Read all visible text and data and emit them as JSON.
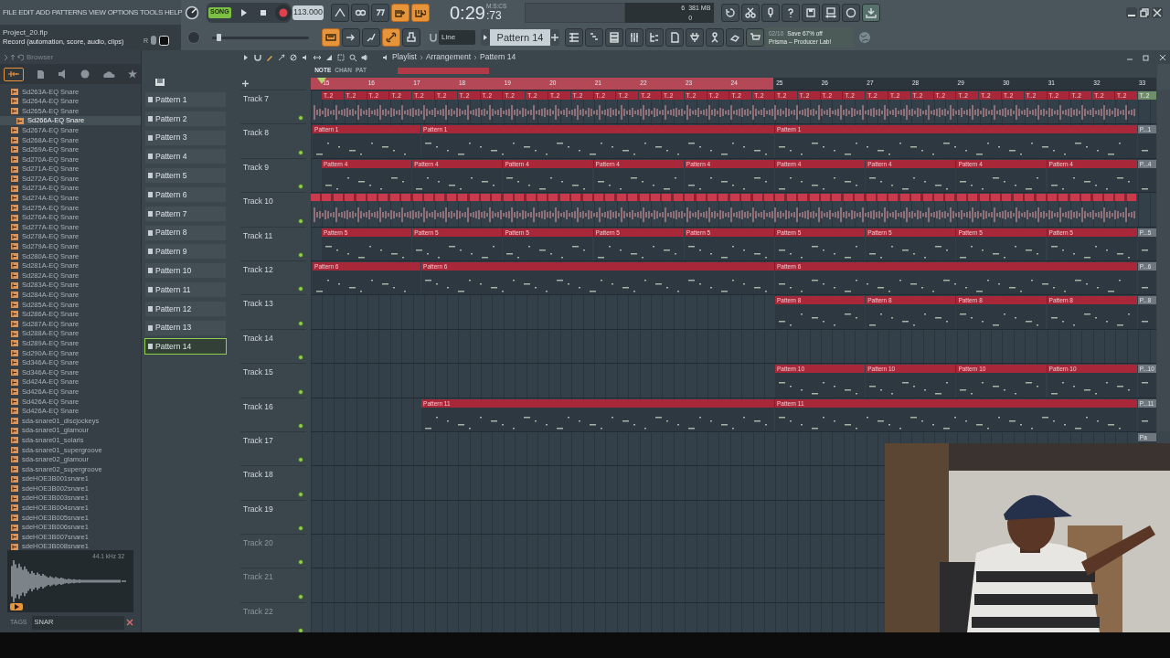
{
  "menu": [
    "FILE",
    "EDIT",
    "ADD",
    "PATTERNS",
    "VIEW",
    "OPTIONS",
    "TOOLS",
    "HELP"
  ],
  "transport": {
    "mode_label": "SONG",
    "song_mode": true,
    "tempo": "113.000"
  },
  "time": {
    "value": "0:29",
    "centis": ":73",
    "unit": "M:S:CS"
  },
  "master_pitch": {
    "level": 0.05
  },
  "monitor": {
    "cpu": "6",
    "ram": "381 MB",
    "voices": "0"
  },
  "hint": {
    "project": "Project_20.flp",
    "text": "Record  (automation, score, audio, clips)",
    "key": "R"
  },
  "snap": "Line",
  "pattern_selector": "Pattern 14",
  "news": {
    "count": "02/10",
    "headline": "Save 67% off",
    "subtitle": "Prisma – Producer Lab!"
  },
  "browser": {
    "title": "Browser",
    "items": [
      {
        "label": "Sd263A-EQ Snare",
        "selected": false
      },
      {
        "label": "Sd264A-EQ Snare",
        "selected": false
      },
      {
        "label": "Sd265A-EQ Snare",
        "selected": false
      },
      {
        "label": "Sd266A-EQ Snare",
        "selected": true
      },
      {
        "label": "Sd267A-EQ Snare",
        "selected": false
      },
      {
        "label": "Sd268A-EQ Snare",
        "selected": false
      },
      {
        "label": "Sd269A-EQ Snare",
        "selected": false
      },
      {
        "label": "Sd270A-EQ Snare",
        "selected": false
      },
      {
        "label": "Sd271A-EQ Snare",
        "selected": false
      },
      {
        "label": "Sd272A-EQ Snare",
        "selected": false
      },
      {
        "label": "Sd273A-EQ Snare",
        "selected": false
      },
      {
        "label": "Sd274A-EQ Snare",
        "selected": false
      },
      {
        "label": "Sd275A-EQ Snare",
        "selected": false
      },
      {
        "label": "Sd276A-EQ Snare",
        "selected": false
      },
      {
        "label": "Sd277A-EQ Snare",
        "selected": false
      },
      {
        "label": "Sd278A-EQ Snare",
        "selected": false
      },
      {
        "label": "Sd279A-EQ Snare",
        "selected": false
      },
      {
        "label": "Sd280A-EQ Snare",
        "selected": false
      },
      {
        "label": "Sd281A-EQ Snare",
        "selected": false
      },
      {
        "label": "Sd282A-EQ Snare",
        "selected": false
      },
      {
        "label": "Sd283A-EQ Snare",
        "selected": false
      },
      {
        "label": "Sd284A-EQ Snare",
        "selected": false
      },
      {
        "label": "Sd285A-EQ Snare",
        "selected": false
      },
      {
        "label": "Sd286A-EQ Snare",
        "selected": false
      },
      {
        "label": "Sd287A-EQ Snare",
        "selected": false
      },
      {
        "label": "Sd288A-EQ Snare",
        "selected": false
      },
      {
        "label": "Sd289A-EQ Snare",
        "selected": false
      },
      {
        "label": "Sd290A-EQ Snare",
        "selected": false
      },
      {
        "label": "Sd346A-EQ Snare",
        "selected": false
      },
      {
        "label": "Sd346A-EQ Snare",
        "selected": false
      },
      {
        "label": "Sd424A-EQ Snare",
        "selected": false
      },
      {
        "label": "Sd426A-EQ Snare",
        "selected": false
      },
      {
        "label": "Sd426A-EQ Snare",
        "selected": false
      },
      {
        "label": "Sd426A-EQ Snare",
        "selected": false
      },
      {
        "label": "sda-snare01_discjockeys",
        "selected": false
      },
      {
        "label": "sda-snare01_glamour",
        "selected": false
      },
      {
        "label": "sda-snare01_solaris",
        "selected": false
      },
      {
        "label": "sda-snare01_supergroove",
        "selected": false
      },
      {
        "label": "sda-snare02_glamour",
        "selected": false
      },
      {
        "label": "sda-snare02_supergroove",
        "selected": false
      },
      {
        "label": "sdeHOE3B001snare1",
        "selected": false
      },
      {
        "label": "sdeHOE3B002snare1",
        "selected": false
      },
      {
        "label": "sdeHOE3B003snare1",
        "selected": false
      },
      {
        "label": "sdeHOE3B004snare1",
        "selected": false
      },
      {
        "label": "sdeHOE3B005snare1",
        "selected": false
      },
      {
        "label": "sdeHOE3B006snare1",
        "selected": false
      },
      {
        "label": "sdeHOE3B007snare1",
        "selected": false
      },
      {
        "label": "sdeHOE3B008snare1",
        "selected": false
      }
    ],
    "sample_info": "44.1 kHz 32",
    "tags_label": "TAGS",
    "search": "SNAR"
  },
  "patterns": [
    {
      "label": "Pattern 1",
      "selected": false
    },
    {
      "label": "Pattern 2",
      "selected": false
    },
    {
      "label": "Pattern 3",
      "selected": false
    },
    {
      "label": "Pattern 4",
      "selected": false
    },
    {
      "label": "Pattern 5",
      "selected": false
    },
    {
      "label": "Pattern 6",
      "selected": false
    },
    {
      "label": "Pattern 7",
      "selected": false
    },
    {
      "label": "Pattern 8",
      "selected": false
    },
    {
      "label": "Pattern 9",
      "selected": false
    },
    {
      "label": "Pattern 10",
      "selected": false
    },
    {
      "label": "Pattern 11",
      "selected": false
    },
    {
      "label": "Pattern 12",
      "selected": false
    },
    {
      "label": "Pattern 13",
      "selected": false
    },
    {
      "label": "Pattern 14",
      "selected": true
    }
  ],
  "playlist": {
    "path": [
      "Playlist",
      "Arrangement",
      "Pattern 14"
    ],
    "tool_tabs": [
      {
        "label": "NOTE",
        "selected": true
      },
      {
        "label": "CHAN",
        "selected": false
      },
      {
        "label": "PAT",
        "selected": false
      }
    ],
    "bars": [
      "15",
      "16",
      "17",
      "18",
      "19",
      "20",
      "21",
      "22",
      "23",
      "24",
      "25",
      "26",
      "27",
      "28",
      "29",
      "30",
      "31",
      "32",
      "33"
    ],
    "tracks": [
      {
        "name": "Track 7",
        "kind": "audio",
        "dimmed": false,
        "clips": [
          {
            "label": "T..2",
            "kind": "clip"
          },
          {
            "label": "T..2",
            "kind": "clip"
          },
          {
            "label": "T..2",
            "kind": "clip"
          },
          {
            "label": "T..2",
            "kind": "clip"
          },
          {
            "label": "T..2",
            "kind": "clip"
          },
          {
            "label": "T..2",
            "kind": "clip"
          },
          {
            "label": "T..2",
            "kind": "clip"
          },
          {
            "label": "T..2",
            "kind": "clip"
          },
          {
            "label": "T..2",
            "kind": "clip"
          },
          {
            "label": "T..2",
            "kind": "clip"
          },
          {
            "label": "T..2",
            "kind": "clip"
          },
          {
            "label": "T..2",
            "kind": "clip"
          },
          {
            "label": "T..2",
            "kind": "clip"
          },
          {
            "label": "T..2",
            "kind": "clip"
          },
          {
            "label": "T..2",
            "kind": "clip"
          },
          {
            "label": "T..2",
            "kind": "clip"
          },
          {
            "label": "T..2",
            "kind": "clip"
          },
          {
            "label": "T..2",
            "kind": "clip"
          },
          {
            "label": "T..2",
            "kind": "clip"
          },
          {
            "label": "T..2",
            "kind": "clip"
          },
          {
            "label": "T..2",
            "kind": "clip"
          },
          {
            "label": "T..2",
            "kind": "clip"
          },
          {
            "label": "T..2",
            "kind": "clip"
          },
          {
            "label": "T..2",
            "kind": "clip"
          },
          {
            "label": "T..2",
            "kind": "clip"
          },
          {
            "label": "T..2",
            "kind": "clip"
          },
          {
            "label": "T..2",
            "kind": "clip"
          },
          {
            "label": "T..2",
            "kind": "clip"
          },
          {
            "label": "T..2",
            "kind": "clip"
          },
          {
            "label": "T..2",
            "kind": "clip"
          },
          {
            "label": "T..2",
            "kind": "clip"
          },
          {
            "label": "T..2",
            "kind": "clip"
          },
          {
            "label": "T..2",
            "kind": "clip"
          },
          {
            "label": "T..2",
            "kind": "clip"
          },
          {
            "label": "T..2",
            "kind": "clip"
          },
          {
            "label": "T..2",
            "kind": "clip"
          },
          {
            "label": "T..2",
            "kind": "tail"
          }
        ]
      },
      {
        "name": "Track 8",
        "kind": "pattern",
        "dimmed": false,
        "clips": [
          {
            "label": "Pattern 1",
            "kind": "clip"
          },
          {
            "label": "Pattern 1",
            "kind": "clip"
          },
          {
            "label": "Pattern 1",
            "kind": "clip"
          },
          {
            "label": "P...1",
            "kind": "tail"
          }
        ]
      },
      {
        "name": "Track 9",
        "kind": "pattern",
        "dimmed": false,
        "clips": [
          {
            "label": "Pattern 4",
            "kind": "clip"
          },
          {
            "label": "Pattern 4",
            "kind": "clip"
          },
          {
            "label": "Pattern 4",
            "kind": "clip"
          },
          {
            "label": "Pattern 4",
            "kind": "clip"
          },
          {
            "label": "Pattern 4",
            "kind": "clip"
          },
          {
            "label": "Pattern 4",
            "kind": "clip"
          },
          {
            "label": "Pattern 4",
            "kind": "clip"
          },
          {
            "label": "Pattern 4",
            "kind": "clip"
          },
          {
            "label": "Pattern 4",
            "kind": "clip"
          },
          {
            "label": "P...4",
            "kind": "tail"
          }
        ]
      },
      {
        "name": "Track 10",
        "kind": "audio",
        "dimmed": false
      },
      {
        "name": "Track 11",
        "kind": "pattern",
        "dimmed": false,
        "clips": [
          {
            "label": "Pattern 5",
            "kind": "clip"
          },
          {
            "label": "Pattern 5",
            "kind": "clip"
          },
          {
            "label": "Pattern 5",
            "kind": "clip"
          },
          {
            "label": "Pattern 5",
            "kind": "clip"
          },
          {
            "label": "Pattern 5",
            "kind": "clip"
          },
          {
            "label": "Pattern 5",
            "kind": "clip"
          },
          {
            "label": "Pattern 5",
            "kind": "clip"
          },
          {
            "label": "Pattern 5",
            "kind": "clip"
          },
          {
            "label": "Pattern 5",
            "kind": "clip"
          },
          {
            "label": "P...5",
            "kind": "tail"
          }
        ]
      },
      {
        "name": "Track 12",
        "kind": "pattern",
        "dimmed": false,
        "clips": [
          {
            "label": "Pattern 6",
            "kind": "clip"
          },
          {
            "label": "Pattern 6",
            "kind": "clip"
          },
          {
            "label": "Pattern 6",
            "kind": "clip"
          },
          {
            "label": "P...6",
            "kind": "tail"
          }
        ]
      },
      {
        "name": "Track 13",
        "kind": "pattern",
        "dimmed": false,
        "clips": [
          {
            "label": "Pattern 8",
            "kind": "clip"
          },
          {
            "label": "Pattern 8",
            "kind": "clip"
          },
          {
            "label": "Pattern 8",
            "kind": "clip"
          },
          {
            "label": "Pattern 8",
            "kind": "clip"
          },
          {
            "label": "P...8",
            "kind": "tail"
          }
        ]
      },
      {
        "name": "Track 14",
        "kind": "pattern",
        "dimmed": false
      },
      {
        "name": "Track 15",
        "kind": "pattern",
        "dimmed": false,
        "clips": [
          {
            "label": "Pattern 10",
            "kind": "clip"
          },
          {
            "label": "Pattern 10",
            "kind": "clip"
          },
          {
            "label": "Pattern 10",
            "kind": "clip"
          },
          {
            "label": "Pattern 10",
            "kind": "clip"
          },
          {
            "label": "P...10",
            "kind": "tail"
          }
        ]
      },
      {
        "name": "Track 16",
        "kind": "pattern",
        "dimmed": false,
        "clips": [
          {
            "label": "Pattern 11",
            "kind": "clip"
          },
          {
            "label": "Pattern 11",
            "kind": "clip"
          },
          {
            "label": "P...11",
            "kind": "tail"
          }
        ]
      },
      {
        "name": "Track 17",
        "kind": "pattern",
        "dimmed": false,
        "clips": [
          {
            "label": "Pa",
            "kind": "tail"
          }
        ]
      },
      {
        "name": "Track 18",
        "kind": "pattern",
        "dimmed": false
      },
      {
        "name": "Track 19",
        "kind": "pattern",
        "dimmed": false
      },
      {
        "name": "Track 20",
        "kind": "pattern",
        "dimmed": true
      },
      {
        "name": "Track 21",
        "kind": "pattern",
        "dimmed": true
      },
      {
        "name": "Track 22",
        "kind": "pattern",
        "dimmed": true
      }
    ]
  }
}
